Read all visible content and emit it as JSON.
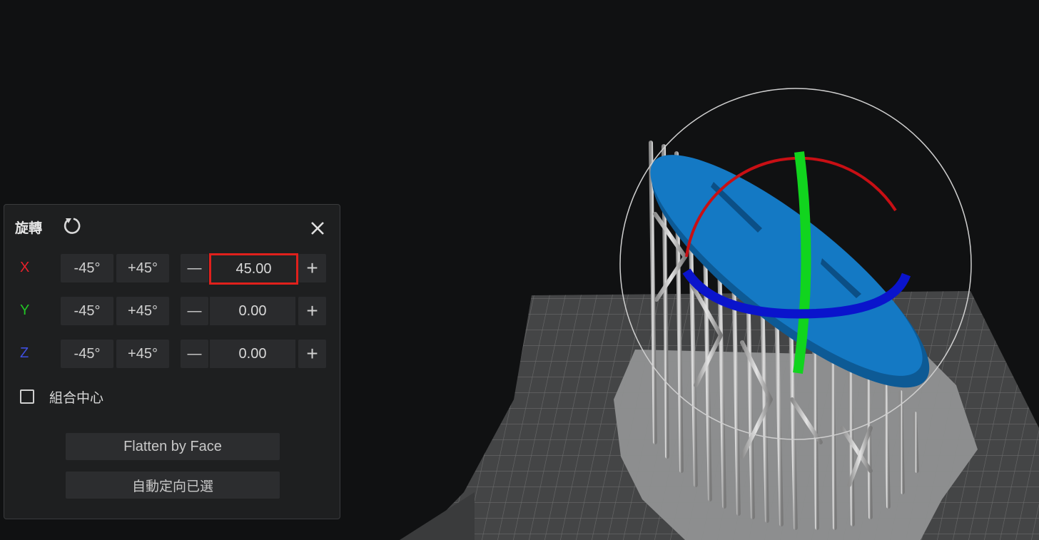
{
  "panel": {
    "title": "旋轉",
    "reset_icon": "reset-rotation-icon",
    "close_icon": "close-icon",
    "step_down_label": "-45°",
    "step_up_label": "+45°",
    "decrement_glyph": "—",
    "increment_glyph": "+",
    "axes": [
      {
        "label": "X",
        "color": "#e8212b",
        "value": "45.00",
        "highlighted": true
      },
      {
        "label": "Y",
        "color": "#22c425",
        "value": "0.00",
        "highlighted": false
      },
      {
        "label": "Z",
        "color": "#3f4fe0",
        "value": "0.00",
        "highlighted": false
      }
    ],
    "group_center": {
      "label": "組合中心",
      "checked": false
    },
    "flatten_button": "Flatten by Face",
    "auto_orient_button": "自動定向已選"
  },
  "scene": {
    "background": "#101112",
    "model_color": "#1479c4",
    "gizmo_colors": {
      "x": "#c80f14",
      "y": "#11d41e",
      "z": "#0a14cc"
    }
  }
}
